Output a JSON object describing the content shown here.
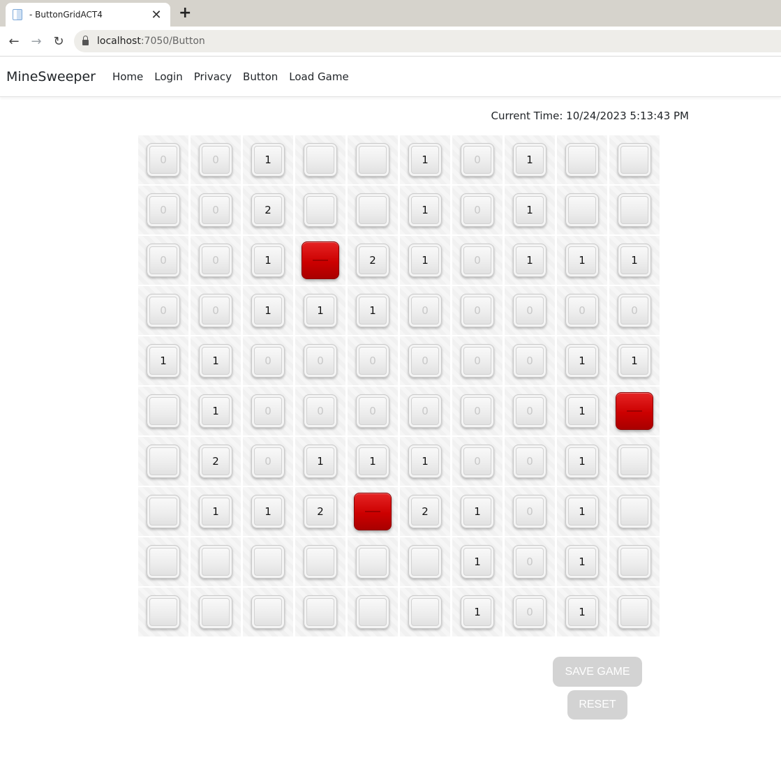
{
  "browser": {
    "tab_title": "- ButtonGridACT4",
    "tab_close": "✕",
    "new_tab": "+",
    "back": "←",
    "forward": "→",
    "reload": "↻",
    "url_host": "localhost",
    "url_path": ":7050/Button"
  },
  "nav": {
    "brand": "MineSweeper",
    "links": [
      "Home",
      "Login",
      "Privacy",
      "Button",
      "Load Game"
    ]
  },
  "clock": "Current Time: 10/24/2023 5:13:43 PM",
  "grid": {
    "rows": [
      [
        "0",
        "0",
        "1",
        "",
        "",
        "1",
        "0",
        "1",
        "",
        ""
      ],
      [
        "0",
        "0",
        "2",
        "",
        "",
        "1",
        "0",
        "1",
        "",
        ""
      ],
      [
        "0",
        "0",
        "1",
        "B",
        "2",
        "1",
        "0",
        "1",
        "1",
        "1"
      ],
      [
        "0",
        "0",
        "1",
        "1",
        "1",
        "0",
        "0",
        "0",
        "0",
        "0"
      ],
      [
        "1",
        "1",
        "0",
        "0",
        "0",
        "0",
        "0",
        "0",
        "1",
        "1"
      ],
      [
        "",
        "1",
        "0",
        "0",
        "0",
        "0",
        "0",
        "0",
        "1",
        "B"
      ],
      [
        "",
        "2",
        "0",
        "1",
        "1",
        "1",
        "0",
        "0",
        "1",
        ""
      ],
      [
        "",
        "1",
        "1",
        "2",
        "B",
        "2",
        "1",
        "0",
        "1",
        ""
      ],
      [
        "",
        "",
        "",
        "",
        "",
        "",
        "1",
        "0",
        "1",
        ""
      ],
      [
        "",
        "",
        "",
        "",
        "",
        "",
        "1",
        "0",
        "1",
        ""
      ]
    ],
    "bomb_color": "#cc0000"
  },
  "actions": {
    "save_label": "SAVE GAME",
    "reset_label": "RESET"
  }
}
